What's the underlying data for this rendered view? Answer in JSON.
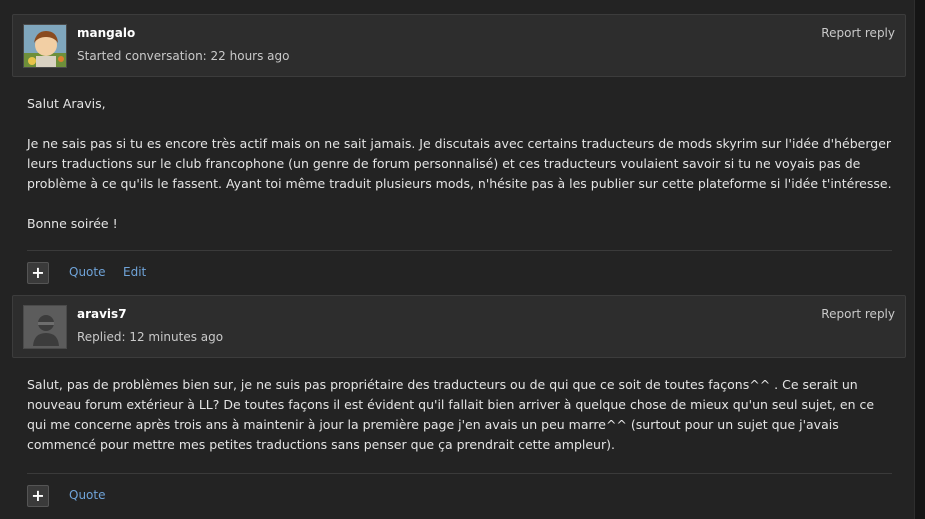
{
  "posts": [
    {
      "author": "mangalo",
      "meta": "Started conversation: 22 hours ago",
      "report": "Report reply",
      "paragraphs": [
        "Salut Aravis,",
        "Je ne sais pas si tu es encore très actif mais on ne sait jamais.  Je discutais avec certains traducteurs de mods skyrim sur l'idée d'héberger leurs traductions sur le club francophone (un genre de forum personnalisé) et ces traducteurs voulaient savoir si tu ne voyais pas de problème à ce qu'ils le fassent.  Ayant toi même traduit plusieurs mods, n'hésite pas à les publier sur cette plateforme si l'idée t'intéresse.",
        "Bonne soirée !"
      ],
      "actions": {
        "plus": "+",
        "quote": "Quote",
        "edit": "Edit"
      }
    },
    {
      "author": "aravis7",
      "meta": "Replied: 12 minutes ago",
      "report": "Report reply",
      "paragraphs": [
        "Salut, pas de problèmes bien sur, je ne suis pas propriétaire des traducteurs ou de qui que ce soit de toutes façons^^ . Ce serait un nouveau forum extérieur à LL? De toutes façons il est évident qu'il fallait bien arriver à quelque chose de mieux qu'un seul sujet, en ce qui me concerne après trois ans à maintenir à jour la première page j'en avais un peu marre^^ (surtout pour un sujet que j'avais commencé pour mettre mes petites traductions sans penser que ça prendrait cette ampleur)."
      ],
      "actions": {
        "plus": "+",
        "quote": "Quote"
      }
    }
  ],
  "colors": {
    "background": "#232323",
    "header": "#2d2d2d",
    "link": "#6fa3d8"
  }
}
